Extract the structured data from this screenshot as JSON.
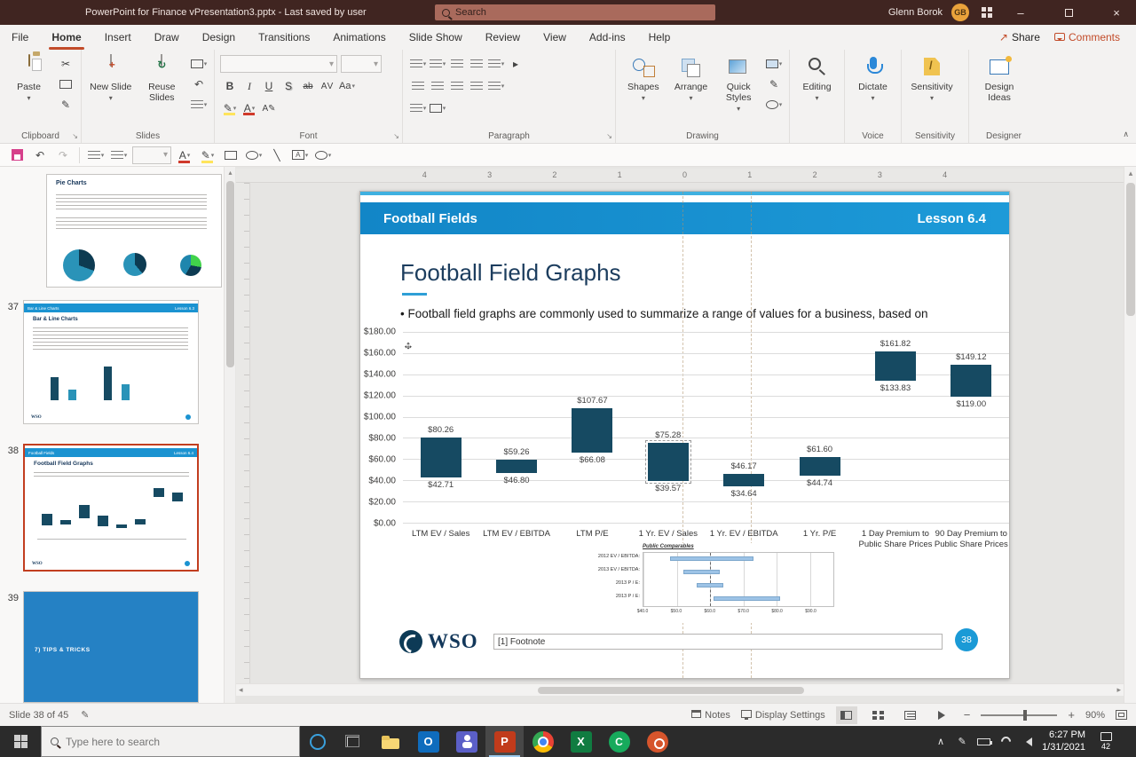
{
  "titlebar": {
    "title": "PowerPoint for Finance vPresentation3.pptx  -  Last saved by user",
    "search_placeholder": "Search",
    "user_name": "Glenn Borok",
    "avatar_initials": "GB"
  },
  "ribbon": {
    "tabs": [
      "File",
      "Home",
      "Insert",
      "Draw",
      "Design",
      "Transitions",
      "Animations",
      "Slide Show",
      "Review",
      "View",
      "Add-ins",
      "Help"
    ],
    "active_tab": "Home",
    "share_label": "Share",
    "comments_label": "Comments",
    "buttons": {
      "paste": "Paste",
      "new_slide": "New Slide",
      "reuse_slides": "Reuse Slides",
      "shapes": "Shapes",
      "arrange": "Arrange",
      "quick_styles": "Quick Styles",
      "editing": "Editing",
      "dictate": "Dictate",
      "sensitivity": "Sensitivity",
      "design_ideas": "Design Ideas"
    },
    "group_labels": [
      "Clipboard",
      "Slides",
      "Font",
      "Paragraph",
      "Drawing",
      "Voice",
      "Sensitivity",
      "Designer"
    ]
  },
  "thumbnails": {
    "slides": [
      {
        "number": "",
        "heading": "Pie Charts"
      },
      {
        "number": "37",
        "header": "Bar & Line Charts",
        "lesson": "Lesson 6.3",
        "heading": "Bar & Line Charts",
        "logo": "WSO"
      },
      {
        "number": "38",
        "header": "Football Fields",
        "lesson": "Lesson 6.4",
        "heading": "Football Field Graphs",
        "logo": "WSO"
      },
      {
        "number": "39",
        "heading": "7) TIPS & TRICKS"
      }
    ]
  },
  "slide": {
    "header_title": "Football Fields",
    "header_lesson": "Lesson 6.4",
    "title": "Football Field Graphs",
    "bullet": "Football field graphs are commonly used to summarize a range of values for a business, based on",
    "footer": {
      "logo_text": "WSO",
      "footnote": "[1] Footnote",
      "page_number": "38"
    }
  },
  "chart_data": [
    {
      "type": "bar",
      "subtype": "floating-range-column",
      "title": "",
      "categories": [
        "LTM EV / Sales",
        "LTM EV / EBITDA",
        "LTM P/E",
        "1 Yr. EV / Sales",
        "1 Yr. EV / EBITDA",
        "1 Yr. P/E",
        "1 Day Premium to\nPublic Share Prices",
        "90 Day Premium to\nPublic Share Prices"
      ],
      "series": [
        {
          "name": "Low",
          "values": [
            42.71,
            46.8,
            66.08,
            39.57,
            34.64,
            44.74,
            133.83,
            119.0
          ]
        },
        {
          "name": "High",
          "values": [
            80.26,
            59.26,
            107.67,
            75.28,
            46.17,
            61.6,
            161.82,
            149.12
          ]
        }
      ],
      "labels_low": [
        "$42.71",
        "$46.80",
        "$66.08",
        "$39.57",
        "$34.64",
        "$44.74",
        "$133.83",
        "$119.00"
      ],
      "labels_high": [
        "$80.26",
        "$59.26",
        "$107.67",
        "$75.28",
        "$46.17",
        "$61.60",
        "$161.82",
        "$149.12"
      ],
      "ylim": [
        0,
        180
      ],
      "y_ticks": [
        "$180.00",
        "$160.00",
        "$140.00",
        "$120.00",
        "$100.00",
        "$80.00",
        "$60.00",
        "$40.00",
        "$20.00",
        "$0.00"
      ],
      "bar_color": "#164a62",
      "grid": true,
      "selected_index": 3
    },
    {
      "type": "bar",
      "subtype": "horizontal-range",
      "title": "Public Comparables",
      "categories": [
        "2012 EV / EBITDA:",
        "2013 EV / EBITDA:",
        "2013 P / E:",
        "2013 P / E:"
      ],
      "series": [
        {
          "name": "Low",
          "values": [
            48,
            52,
            56,
            61
          ]
        },
        {
          "name": "High",
          "values": [
            73,
            63,
            64,
            81
          ]
        }
      ],
      "xlim": [
        40,
        97
      ],
      "x_ticks": [
        "$40.0",
        "$50.0",
        "$60.0",
        "$70.0",
        "$80.0",
        "$90.0"
      ],
      "tick_values": [
        40,
        50,
        60,
        70,
        80,
        90
      ],
      "marker": 60,
      "bar_color": "#9dc3e6",
      "grid": true
    }
  ],
  "rulers": {
    "horizontal": [
      "4",
      "3",
      "2",
      "1",
      "0",
      "1",
      "2",
      "3",
      "4"
    ]
  },
  "statusbar": {
    "slide_counter": "Slide 38 of 45",
    "notes_label": "Notes",
    "display_settings_label": "Display Settings",
    "zoom_level": "90%"
  },
  "taskbar": {
    "search_placeholder": "Type here to search",
    "apps": [
      "file-explorer",
      "outlook",
      "teams",
      "powerpoint",
      "chrome",
      "excel",
      "camtasia",
      "recorder"
    ],
    "active_app": "powerpoint",
    "tray": [
      "chevron-up",
      "pen",
      "battery",
      "wifi",
      "volume"
    ],
    "time": "6:27 PM",
    "date": "1/31/2021",
    "notification_count": "42"
  },
  "icons": {
    "cut": "✂",
    "undo": "↶",
    "redo": "↷",
    "caret-down": "▾",
    "caret-up": "▴",
    "caret-left": "◂",
    "caret-right": "▸",
    "bold": "B",
    "italic": "I",
    "underline": "U",
    "shadow": "S",
    "strikethrough": "ab",
    "char-spacing": "AV",
    "change-case": "Aa",
    "pen": "✎",
    "font-color": "A",
    "line": "╲",
    "minimize": "–",
    "close": "×",
    "share": "↗",
    "chevron-up": "∧",
    "move-h": "↔",
    "move-v": "↕",
    "launcher": "↘"
  }
}
